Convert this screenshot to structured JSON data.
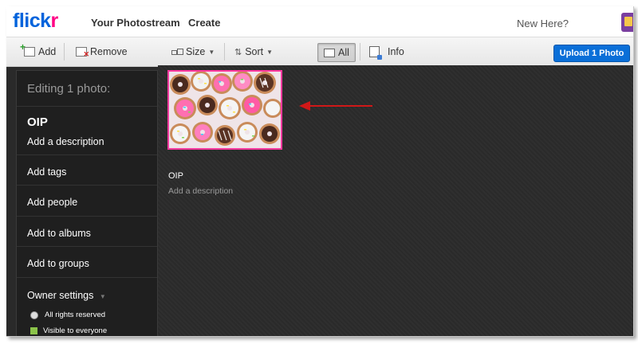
{
  "nav": {
    "logo_part1": "flick",
    "logo_part2": "r",
    "links": [
      "Your Photostream",
      "Create"
    ],
    "new_here": "New Here?"
  },
  "toolbar": {
    "add": "Add",
    "remove": "Remove",
    "size": "Size",
    "sort": "Sort",
    "all": "All",
    "info": "Info",
    "upload": "Upload 1 Photo"
  },
  "sidebar": {
    "heading": "Editing 1 photo:",
    "photo_title": "OIP",
    "add_description": "Add a description",
    "add_tags": "Add tags",
    "add_people": "Add people",
    "add_albums": "Add to albums",
    "add_groups": "Add to groups",
    "owner_settings": "Owner settings",
    "rights": "All rights reserved",
    "visibility": "Visible to everyone"
  },
  "photo": {
    "title": "OIP",
    "description": "Add a description"
  },
  "colors": {
    "brand_blue": "#0063dc",
    "brand_pink": "#ff0084",
    "selection_border": "#ff3aa0",
    "upload_button": "#0a6fd8",
    "arrow": "#d01818"
  }
}
